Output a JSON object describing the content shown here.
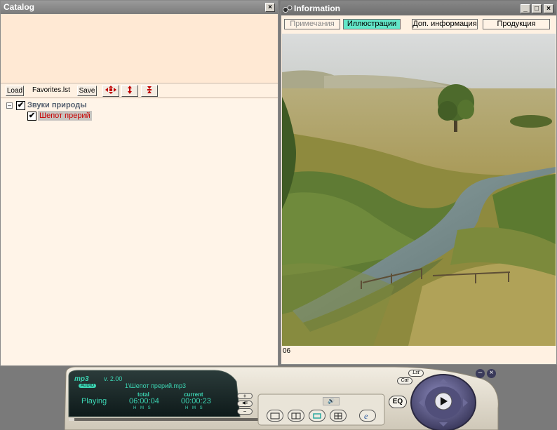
{
  "catalog": {
    "title": "Catalog",
    "close_symbol": "×",
    "toolbar": {
      "load_label": "Load",
      "file_label": "Favorites.lst",
      "save_label": "Save"
    },
    "tree": {
      "root_label": "Звуки природы",
      "child_label": "Шепот прерий"
    }
  },
  "info": {
    "title": "Information",
    "window_symbols": {
      "minimize": "_",
      "maximize": "□",
      "close": "×"
    },
    "tabs": [
      {
        "label": "Примечания",
        "state": "disabled"
      },
      {
        "label": "Иллюстрации",
        "state": "active"
      },
      {
        "label": "Доп. информация",
        "state": "normal"
      },
      {
        "label": "Продукция",
        "state": "normal"
      }
    ],
    "caption": "06"
  },
  "player": {
    "logo": "mp3",
    "badge": "AUDIO",
    "version": "v. 2.00",
    "track": "1\\Шепот прерий.mp3",
    "status": "Playing",
    "total_label": "total",
    "total_time": "06:00:04",
    "current_label": "current",
    "current_time": "00:00:23",
    "hms_label": "H M S",
    "eq_label": "EQ",
    "lst_label": "Lst",
    "cat_label": "Cat",
    "vol_plus": "+",
    "vol_minus": "−",
    "balance_label": "◀≡",
    "accent_color": "#3cd6b4"
  }
}
